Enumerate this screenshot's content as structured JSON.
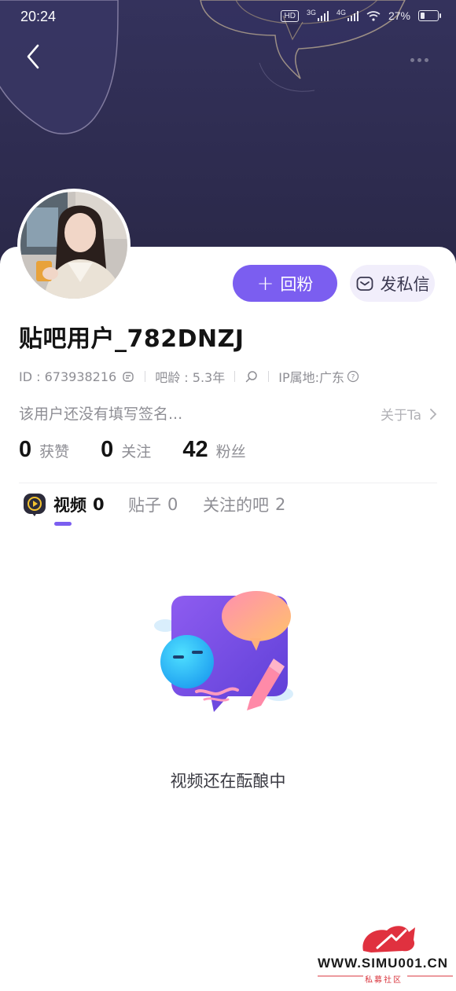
{
  "status_bar": {
    "time": "20:24",
    "hd_label": "HD",
    "network_3g": "3G",
    "network_4g": "4G",
    "battery_text": "27%"
  },
  "profile": {
    "username": "贴吧用户_782DNZJ",
    "id_text": "ID : 673938216",
    "age_text": "吧龄 : 5.3年",
    "ip_text": "IP属地:广东",
    "bio": "该用户还没有填写签名...",
    "about_label": "关于Ta"
  },
  "actions": {
    "follow_back": "回粉",
    "message": "发私信"
  },
  "stats": [
    {
      "num": "0",
      "label": "获赞"
    },
    {
      "num": "0",
      "label": "关注"
    },
    {
      "num": "42",
      "label": "粉丝"
    }
  ],
  "tabs": [
    {
      "label": "视频",
      "count": "0"
    },
    {
      "label": "贴子",
      "count": "0"
    },
    {
      "label": "关注的吧",
      "count": "2"
    }
  ],
  "empty_state": {
    "text": "视频还在酝酿中"
  },
  "watermark": {
    "url": "WWW.SIMU001.CN",
    "sub": "私募社区"
  },
  "colors": {
    "header_bg": "#2d2b4f",
    "accent": "#7b5ef0",
    "muted_text": "#8e8e94"
  }
}
